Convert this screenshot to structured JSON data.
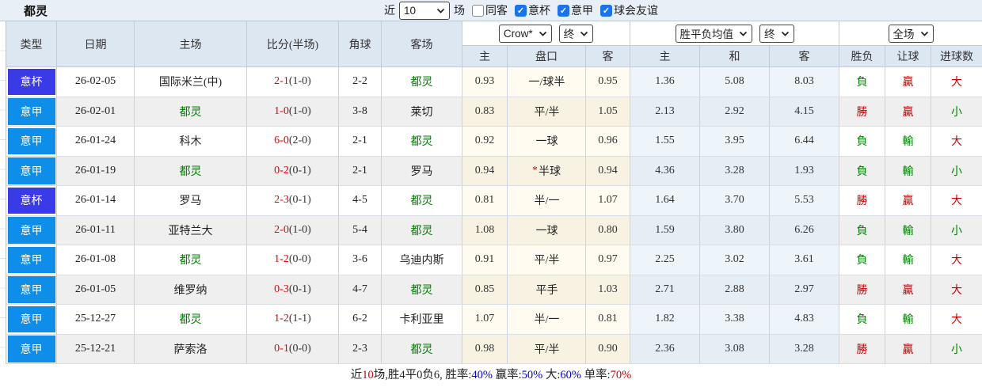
{
  "topbar": {
    "team": "都灵",
    "recent_label": "近",
    "count_select": "10",
    "unit_label": "场",
    "filters": [
      {
        "label": "同客",
        "state": "unchecked"
      },
      {
        "label": "意杯",
        "state": "checked"
      },
      {
        "label": "意甲",
        "state": "checked"
      },
      {
        "label": "球会友谊",
        "state": "checked"
      }
    ]
  },
  "table": {
    "main_headers": [
      "类型",
      "日期",
      "主场",
      "比分(半场)",
      "角球",
      "客场"
    ],
    "selects": {
      "company": "Crow*",
      "time_a": "终",
      "avg": "胜平负均值",
      "time_b": "终",
      "scope": "全场"
    },
    "sub_headers": [
      "主",
      "盘口",
      "客",
      "主",
      "和",
      "客",
      "胜负",
      "让球",
      "进球数"
    ],
    "colors": {
      "cup_badge": "#3a3ae8",
      "league_badge": "#0e8ee8",
      "score_red": "#e60000",
      "team_green": "#008000",
      "win_red": "#cc0000",
      "lose_green": "#008000",
      "stat_blue": "#0000cc"
    },
    "rows": [
      {
        "type": "意杯",
        "type_class": "cup",
        "date": "26-02-05",
        "home": "国际米兰(中)",
        "home_class": "black",
        "score": "2-1",
        "half": "(1-0)",
        "corners": "2-2",
        "away": "都灵",
        "away_class": "green",
        "odds_home": "0.93",
        "hstar": "",
        "handicap": "一/球半",
        "odds_away": "0.95",
        "avg_home": "1.36",
        "avg_draw": "5.08",
        "avg_away": "8.03",
        "result": "負",
        "result_class": "green",
        "spread": "贏",
        "spread_class": "red",
        "goals": "大",
        "goals_class": "red"
      },
      {
        "type": "意甲",
        "type_class": "league",
        "date": "26-02-01",
        "home": "都灵",
        "home_class": "green",
        "score": "1-0",
        "half": "(1-0)",
        "corners": "3-8",
        "away": "莱切",
        "away_class": "black",
        "odds_home": "0.83",
        "hstar": "",
        "handicap": "平/半",
        "odds_away": "1.05",
        "avg_home": "2.13",
        "avg_draw": "2.92",
        "avg_away": "4.15",
        "result": "勝",
        "result_class": "red",
        "spread": "贏",
        "spread_class": "red",
        "goals": "小",
        "goals_class": "green"
      },
      {
        "type": "意甲",
        "type_class": "league",
        "date": "26-01-24",
        "home": "科木",
        "home_class": "black",
        "score": "6-0",
        "half": "(2-0)",
        "corners": "2-1",
        "away": "都灵",
        "away_class": "green",
        "odds_home": "0.92",
        "hstar": "",
        "handicap": "一球",
        "odds_away": "0.96",
        "avg_home": "1.55",
        "avg_draw": "3.95",
        "avg_away": "6.44",
        "result": "負",
        "result_class": "green",
        "spread": "輸",
        "spread_class": "green",
        "goals": "大",
        "goals_class": "red"
      },
      {
        "type": "意甲",
        "type_class": "league",
        "date": "26-01-19",
        "home": "都灵",
        "home_class": "green",
        "score": "0-2",
        "half": "(0-1)",
        "corners": "2-1",
        "away": "罗马",
        "away_class": "black",
        "odds_home": "0.94",
        "hstar": "*",
        "handicap": "半球",
        "odds_away": "0.94",
        "avg_home": "4.36",
        "avg_draw": "3.28",
        "avg_away": "1.93",
        "result": "負",
        "result_class": "green",
        "spread": "輸",
        "spread_class": "green",
        "goals": "小",
        "goals_class": "green"
      },
      {
        "type": "意杯",
        "type_class": "cup",
        "date": "26-01-14",
        "home": "罗马",
        "home_class": "black",
        "score": "2-3",
        "half": "(0-1)",
        "corners": "4-5",
        "away": "都灵",
        "away_class": "green",
        "odds_home": "0.81",
        "hstar": "",
        "handicap": "半/一",
        "odds_away": "1.07",
        "avg_home": "1.64",
        "avg_draw": "3.70",
        "avg_away": "5.53",
        "result": "勝",
        "result_class": "red",
        "spread": "贏",
        "spread_class": "red",
        "goals": "大",
        "goals_class": "red"
      },
      {
        "type": "意甲",
        "type_class": "league",
        "date": "26-01-11",
        "home": "亚特兰大",
        "home_class": "black",
        "score": "2-0",
        "half": "(1-0)",
        "corners": "5-4",
        "away": "都灵",
        "away_class": "green",
        "odds_home": "1.08",
        "hstar": "",
        "handicap": "一球",
        "odds_away": "0.80",
        "avg_home": "1.59",
        "avg_draw": "3.80",
        "avg_away": "6.26",
        "result": "負",
        "result_class": "green",
        "spread": "輸",
        "spread_class": "green",
        "goals": "小",
        "goals_class": "green"
      },
      {
        "type": "意甲",
        "type_class": "league",
        "date": "26-01-08",
        "home": "都灵",
        "home_class": "green",
        "score": "1-2",
        "half": "(0-0)",
        "corners": "3-6",
        "away": "乌迪内斯",
        "away_class": "black",
        "odds_home": "0.91",
        "hstar": "",
        "handicap": "平/半",
        "odds_away": "0.97",
        "avg_home": "2.25",
        "avg_draw": "3.02",
        "avg_away": "3.61",
        "result": "負",
        "result_class": "green",
        "spread": "輸",
        "spread_class": "green",
        "goals": "大",
        "goals_class": "red"
      },
      {
        "type": "意甲",
        "type_class": "league",
        "date": "26-01-05",
        "home": "维罗纳",
        "home_class": "black",
        "score": "0-3",
        "half": "(0-1)",
        "corners": "4-7",
        "away": "都灵",
        "away_class": "green",
        "odds_home": "0.85",
        "hstar": "",
        "handicap": "平手",
        "odds_away": "1.03",
        "avg_home": "2.71",
        "avg_draw": "2.88",
        "avg_away": "2.97",
        "result": "勝",
        "result_class": "red",
        "spread": "贏",
        "spread_class": "red",
        "goals": "大",
        "goals_class": "red"
      },
      {
        "type": "意甲",
        "type_class": "league",
        "date": "25-12-27",
        "home": "都灵",
        "home_class": "green",
        "score": "1-2",
        "half": "(1-1)",
        "corners": "6-2",
        "away": "卡利亚里",
        "away_class": "black",
        "odds_home": "1.07",
        "hstar": "",
        "handicap": "半/一",
        "odds_away": "0.81",
        "avg_home": "1.82",
        "avg_draw": "3.38",
        "avg_away": "4.83",
        "result": "負",
        "result_class": "green",
        "spread": "輸",
        "spread_class": "green",
        "goals": "大",
        "goals_class": "red"
      },
      {
        "type": "意甲",
        "type_class": "league",
        "date": "25-12-21",
        "home": "萨索洛",
        "home_class": "black",
        "score": "0-1",
        "half": "(0-0)",
        "corners": "2-3",
        "away": "都灵",
        "away_class": "green",
        "odds_home": "0.98",
        "hstar": "",
        "handicap": "平/半",
        "odds_away": "0.90",
        "avg_home": "2.36",
        "avg_draw": "3.08",
        "avg_away": "3.28",
        "result": "勝",
        "result_class": "red",
        "spread": "贏",
        "spread_class": "red",
        "goals": "小",
        "goals_class": "green"
      }
    ]
  },
  "footer": {
    "segments": [
      {
        "text": "近",
        "color": "black"
      },
      {
        "text": "10",
        "color": "red"
      },
      {
        "text": "场,胜4平0负6, 胜率:",
        "color": "black"
      },
      {
        "text": "40%",
        "color": "blue"
      },
      {
        "text": " 赢率:",
        "color": "black"
      },
      {
        "text": "50%",
        "color": "blue"
      },
      {
        "text": " 大:",
        "color": "black"
      },
      {
        "text": "60%",
        "color": "blue"
      },
      {
        "text": " 单率:",
        "color": "black"
      },
      {
        "text": "70%",
        "color": "red"
      }
    ]
  }
}
